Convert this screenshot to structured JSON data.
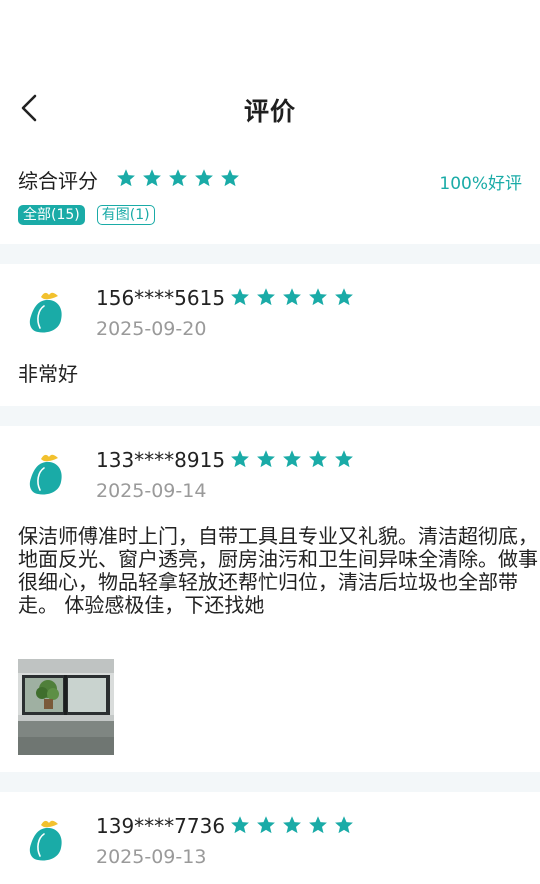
{
  "header": {
    "title": "评价",
    "back_icon": "chevron-left-icon"
  },
  "summary": {
    "label": "综合评分",
    "rating": 5,
    "rating_max": 5,
    "good_rate": "100%好评",
    "filters": [
      {
        "label": "全部(15)",
        "active": true
      },
      {
        "label": "有图(1)",
        "active": false
      }
    ]
  },
  "reviews": [
    {
      "user": "156****5615",
      "rating": 5,
      "date": "2025-09-20",
      "text": "非常好",
      "has_photo": false
    },
    {
      "user": "133****8915",
      "rating": 5,
      "date": "2025-09-14",
      "text": "保洁师傅准时上门，自带工具且专业又礼貌。清洁超彻底，地面反光、窗户透亮，厨房油污和卫生间异味全清除。做事很细心，物品轻拿轻放还帮忙归位，清洁后垃圾也全部带走。 体验感极佳，下还找她",
      "has_photo": true
    },
    {
      "user": "139****7736",
      "rating": 5,
      "date": "2025-09-13",
      "text": "",
      "has_photo": false
    }
  ],
  "colors": {
    "accent": "#1aaba7",
    "divider": "#f3f7f9",
    "date": "#9a9a9a"
  }
}
